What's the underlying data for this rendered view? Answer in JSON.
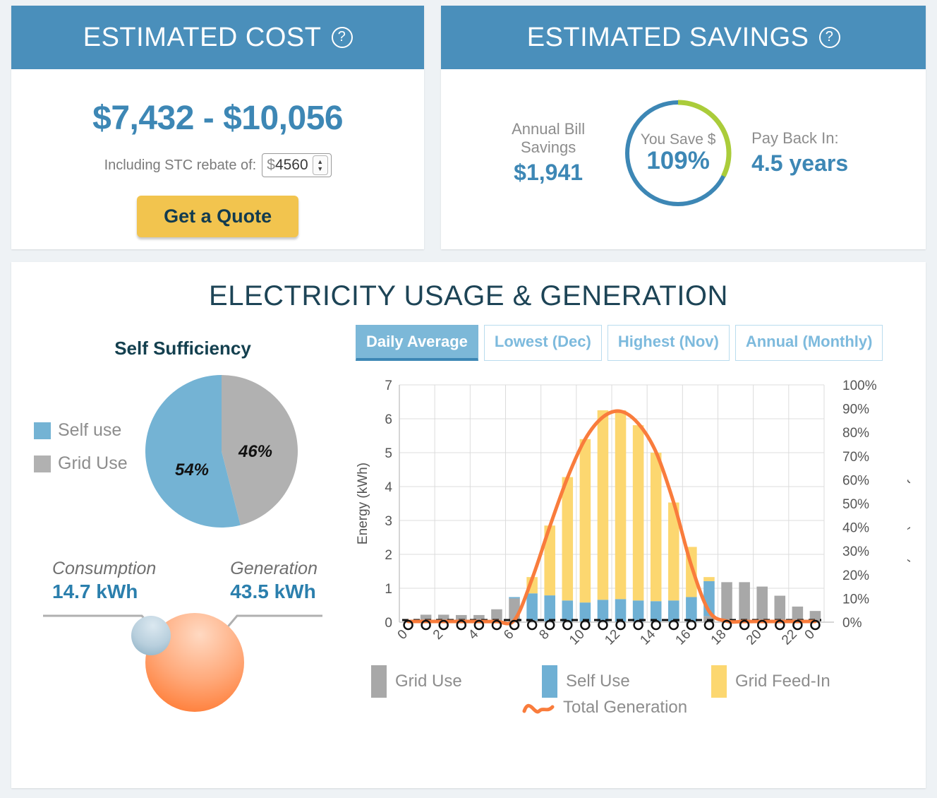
{
  "cost_card": {
    "header": "ESTIMATED COST",
    "help_icon": "question-mark-circle-icon",
    "price_range": "$7,432 - $10,056",
    "rebate_label": "Including STC rebate of:",
    "rebate_currency": "$",
    "rebate_value": "4560",
    "quote_button": "Get a Quote"
  },
  "savings_card": {
    "header": "ESTIMATED SAVINGS",
    "help_icon": "question-mark-circle-icon",
    "annual_label_line1": "Annual Bill",
    "annual_label_line2": "Savings",
    "annual_value": "$1,941",
    "ring_label": "You Save $",
    "ring_value": "109%",
    "payback_label": "Pay Back In:",
    "payback_value": "4.5 years",
    "ring_overage_percent": 9
  },
  "panel": {
    "title": "ELECTRICITY USAGE & GENERATION",
    "self_sufficiency_title": "Self Sufficiency",
    "pie_legend": [
      {
        "label": "Self use",
        "color": "#74b3d4"
      },
      {
        "label": "Grid Use",
        "color": "#b1b1b1"
      }
    ],
    "consumption_caption": "Consumption",
    "consumption_value": "14.7 kWh",
    "generation_caption": "Generation",
    "generation_value": "43.5 kWh",
    "tabs": [
      {
        "label": "Daily Average",
        "active": true
      },
      {
        "label": "Lowest (Dec)",
        "active": false
      },
      {
        "label": "Highest (Nov)",
        "active": false
      },
      {
        "label": "Annual (Monthly)",
        "active": false
      }
    ],
    "chart_legend": [
      {
        "label": "Grid Use",
        "type": "swatch",
        "color": "#a8a8a8"
      },
      {
        "label": "Self Use",
        "type": "swatch",
        "color": "#6fb0d4"
      },
      {
        "label": "Grid Feed-In",
        "type": "swatch",
        "color": "#fcd770"
      },
      {
        "label": "Total Generation",
        "type": "line",
        "color": "#f97c3c"
      }
    ]
  },
  "chart_data": [
    {
      "type": "pie",
      "title": "Self Sufficiency",
      "categories": [
        "Self use",
        "Grid Use"
      ],
      "values": [
        54,
        46
      ],
      "labels": [
        "54%",
        "46%"
      ],
      "colors": [
        "#74b3d4",
        "#b1b1b1"
      ],
      "legend": "left"
    },
    {
      "type": "bar",
      "title": "Electricity Usage & Generation - Daily Average",
      "stacked": true,
      "xlabel": "",
      "ylabel": "Energy (kWh)",
      "y2label": "Battery Level (SOC)",
      "ylim": [
        0,
        7
      ],
      "y2lim": [
        0,
        100
      ],
      "yticks": [
        0,
        1,
        2,
        3,
        4,
        5,
        6,
        7
      ],
      "y2ticks": [
        "0%",
        "10%",
        "20%",
        "30%",
        "40%",
        "50%",
        "60%",
        "70%",
        "80%",
        "90%",
        "100%"
      ],
      "x": [
        0,
        1,
        2,
        3,
        4,
        5,
        6,
        7,
        8,
        9,
        10,
        11,
        12,
        13,
        14,
        15,
        16,
        17,
        18,
        19,
        20,
        21,
        22,
        23
      ],
      "xtick_labels": [
        "0",
        "",
        "2",
        "",
        "4",
        "",
        "6",
        "",
        "8",
        "",
        "10",
        "",
        "12",
        "",
        "14",
        "",
        "16",
        "",
        "18",
        "",
        "20",
        "",
        "22",
        "0"
      ],
      "grid": true,
      "legend": "bottom",
      "series": [
        {
          "name": "Grid Use",
          "color": "#a8a8a8",
          "values": [
            0.0,
            0.22,
            0.22,
            0.21,
            0.21,
            0.38,
            0.7,
            0.05,
            0.03,
            0.02,
            0.02,
            0.02,
            0.02,
            0.02,
            0.02,
            0.02,
            0.02,
            0.18,
            1.18,
            1.18,
            1.05,
            0.78,
            0.46,
            0.33,
            0.26
          ]
        },
        {
          "name": "Self Use",
          "color": "#6fb0d4",
          "values": [
            0.0,
            0.0,
            0.0,
            0.0,
            0.0,
            0.0,
            0.04,
            0.8,
            0.76,
            0.62,
            0.56,
            0.64,
            0.66,
            0.62,
            0.6,
            0.62,
            0.72,
            1.03,
            0.0,
            0.0,
            0.0,
            0.0,
            0.0,
            0.0
          ]
        },
        {
          "name": "Grid Feed-In",
          "color": "#fcd770",
          "values": [
            0.0,
            0.0,
            0.0,
            0.0,
            0.0,
            0.0,
            0.0,
            0.48,
            2.06,
            3.64,
            4.82,
            5.59,
            5.57,
            5.17,
            4.38,
            2.89,
            1.48,
            0.12,
            0.0,
            0.0,
            0.0,
            0.0,
            0.0,
            0.0
          ]
        }
      ],
      "line_series": {
        "name": "Total Generation",
        "color": "#f97c3c",
        "values": [
          0.02,
          0.02,
          0.02,
          0.02,
          0.02,
          0.02,
          0.06,
          1.28,
          2.82,
          4.26,
          5.4,
          6.05,
          6.22,
          5.86,
          5.02,
          3.53,
          1.67,
          0.32,
          0.03,
          0.02,
          0.02,
          0.02,
          0.02,
          0.02
        ]
      },
      "battery_soc_baseline": 0
    }
  ]
}
